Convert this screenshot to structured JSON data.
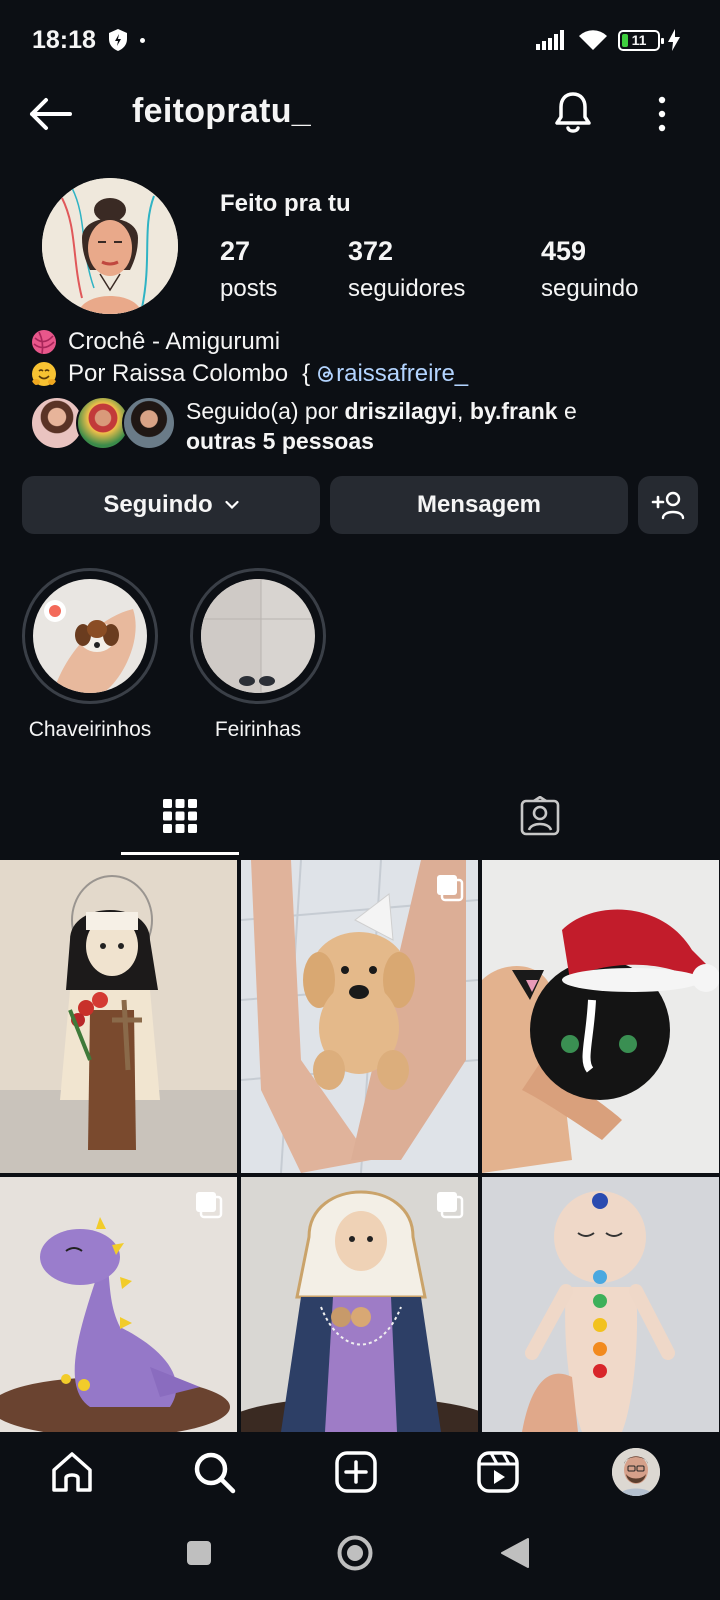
{
  "status_bar": {
    "time": "18:18",
    "battery": "11"
  },
  "header": {
    "username": "feitopratu_"
  },
  "profile": {
    "display_name": "Feito pra tu",
    "stats": [
      {
        "value": "27",
        "label": "posts"
      },
      {
        "value": "372",
        "label": "seguidores"
      },
      {
        "value": "459",
        "label": "seguindo"
      }
    ],
    "bio": {
      "line1": "Crochê - Amigurumi",
      "line2_text": "Por Raissa Colombo",
      "line2_brace": "{",
      "line2_link": "raissafreire_"
    },
    "followed_by": {
      "prefix": "Seguido(a) por",
      "name1": "driszilagyi",
      "sep": ",",
      "name2": "by.frank",
      "conj": "e",
      "others": "outras 5 pessoas"
    }
  },
  "buttons": {
    "following": "Seguindo",
    "message": "Mensagem"
  },
  "highlights": [
    {
      "label": "Chaveirinhos"
    },
    {
      "label": "Feirinhas"
    }
  ],
  "colors": {
    "background": "#0c0f14",
    "button": "#262a31",
    "link": "#b3d4ff"
  },
  "icons": [
    "back-arrow-icon",
    "bell-icon",
    "more-vertical-icon",
    "grid-icon",
    "tagged-icon",
    "home-icon",
    "search-icon",
    "create-icon",
    "reels-icon"
  ]
}
